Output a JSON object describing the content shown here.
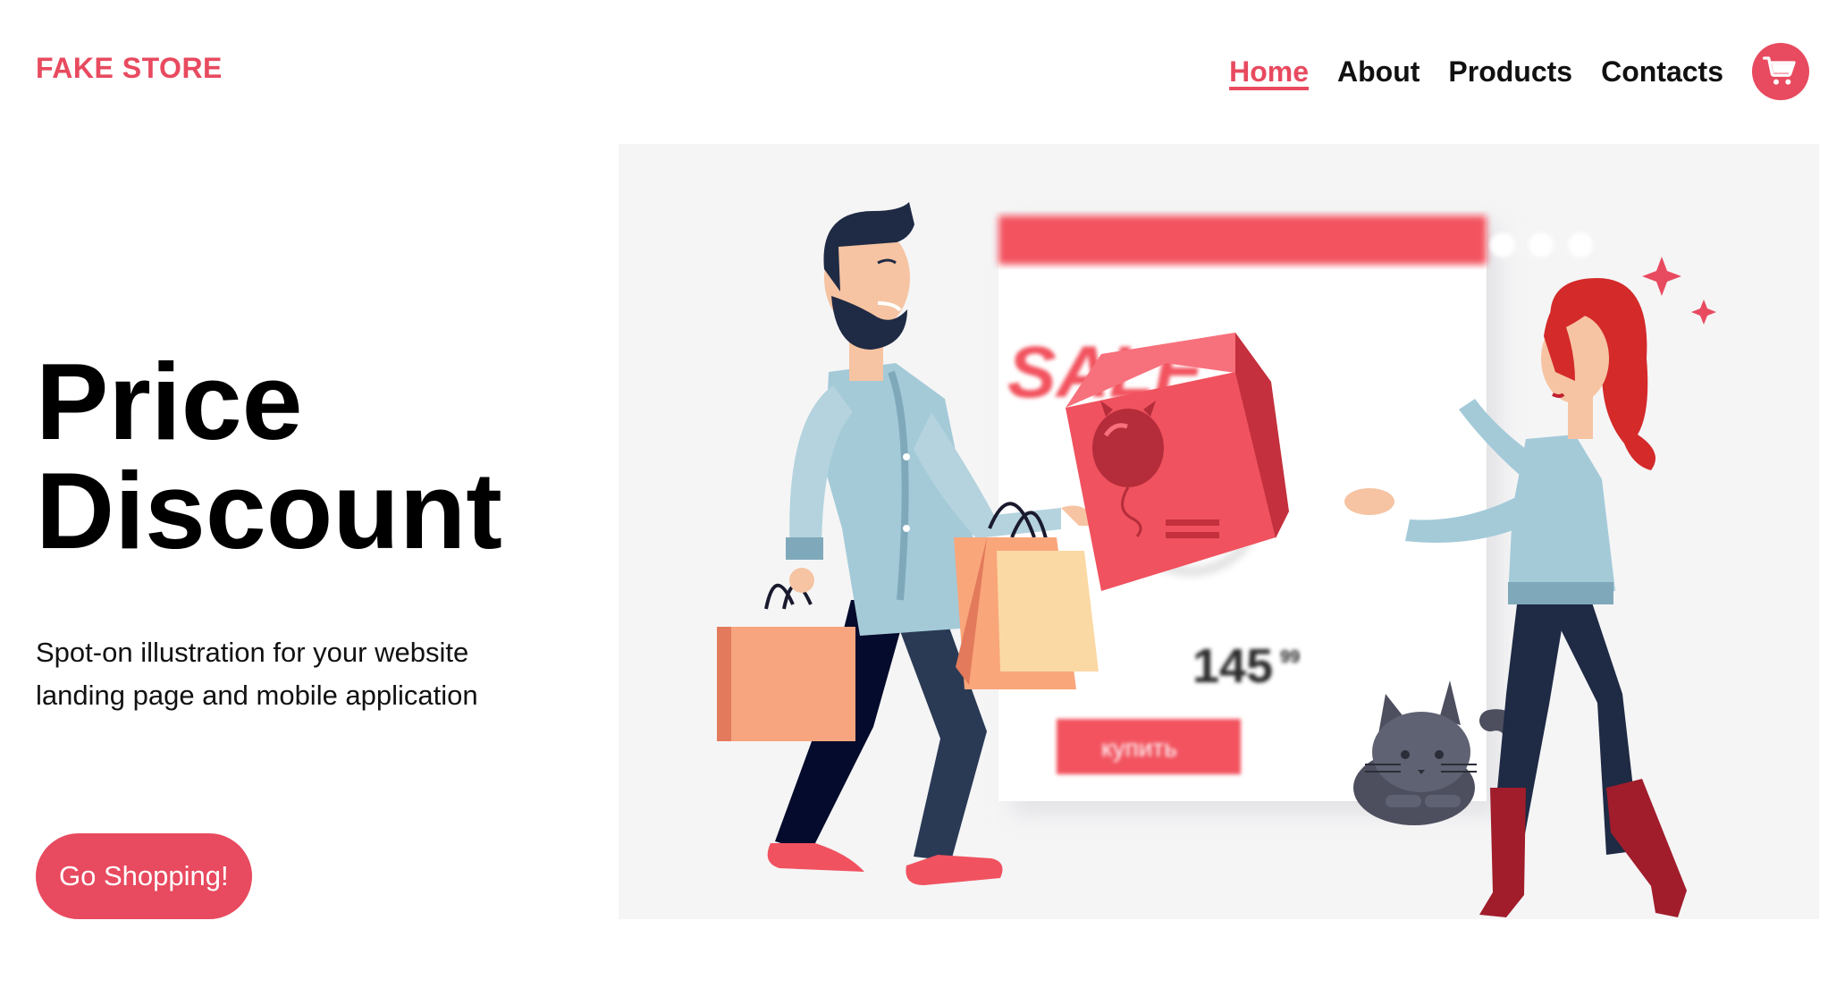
{
  "brand": {
    "name": "FAKE STORE",
    "accent": "#e84a5f"
  },
  "nav": {
    "items": [
      {
        "label": "Home",
        "active": true
      },
      {
        "label": "About",
        "active": false
      },
      {
        "label": "Products",
        "active": false
      },
      {
        "label": "Contacts",
        "active": false
      }
    ],
    "cart_icon": "shopping-cart-icon"
  },
  "hero": {
    "title_line1": "Price",
    "title_line2": "Discount",
    "subtitle": "Spot-on illustration for your website landing page and mobile application",
    "cta_label": "Go Shopping!",
    "illustration": {
      "sale_text": "SALE",
      "price_main": "145",
      "price_cents": "99",
      "buy_button_text": "купить",
      "percent_symbol": "%"
    }
  }
}
